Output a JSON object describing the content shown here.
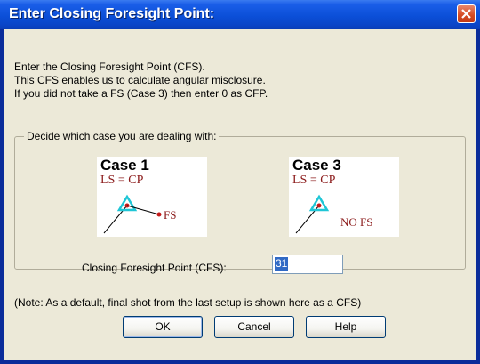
{
  "window": {
    "title": "Enter Closing Foresight Point:"
  },
  "intro": {
    "line1": "Enter the Closing Foresight Point (CFS).",
    "line2": "This CFS enables us to calculate angular misclosure.",
    "line3": "If you did not take a FS (Case 3) then enter 0 as CFP."
  },
  "group": {
    "label": "Decide which case you are dealing with:",
    "case1": {
      "title": "Case 1",
      "subtitle": "LS = CP",
      "fs_label": "FS"
    },
    "case3": {
      "title": "Case 3",
      "subtitle": "LS = CP",
      "fs_label": "NO FS"
    }
  },
  "cfs": {
    "label": "Closing Foresight Point (CFS):",
    "value": "31"
  },
  "note": "(Note: As a default, final shot from the last setup is shown here as a CFS)",
  "buttons": {
    "ok": "OK",
    "cancel": "Cancel",
    "help": "Help"
  },
  "colors": {
    "title_blue": "#0b4fd8",
    "dialog_bg": "#ece9d8",
    "diagram_red": "#8b1a1a",
    "diagram_cyan": "#1fc6d6"
  }
}
